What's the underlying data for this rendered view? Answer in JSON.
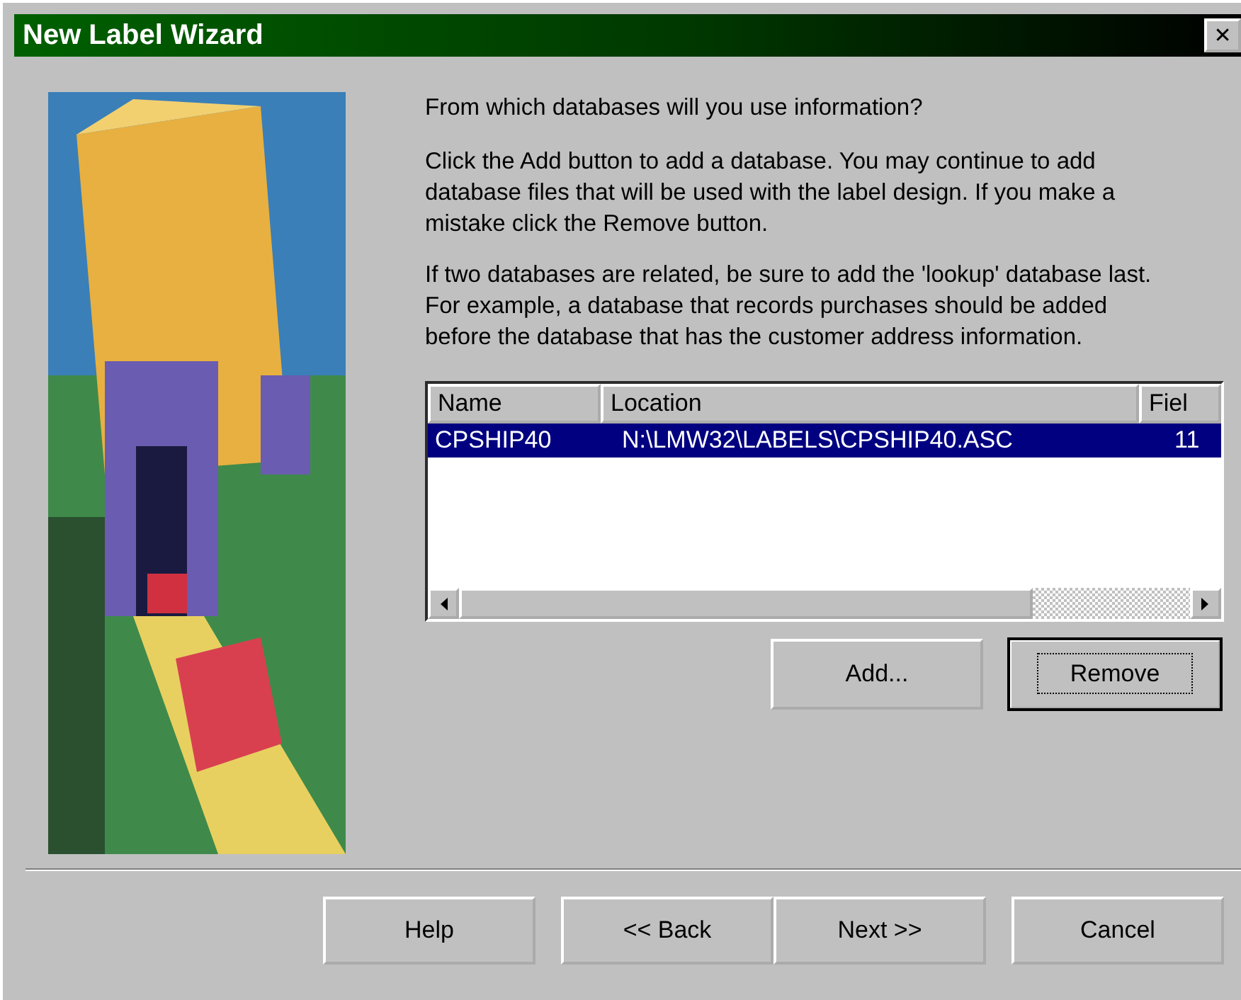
{
  "window": {
    "title": "New Label Wizard",
    "close": "✕"
  },
  "intro": {
    "question": "From which databases will you use information?",
    "paragraphs": [
      "Click the Add button to add a database.  You may continue to add database files that will be used with the label design.  If you make a mistake click the Remove button.",
      "If two databases are related, be sure to add the 'lookup' database last. For example, a database that records purchases should be added before the database that has the customer address information."
    ]
  },
  "table": {
    "columns": [
      "Name",
      "Location",
      "Fiel"
    ],
    "rows": [
      {
        "cells": [
          "CPSHIP40",
          "N:\\LMW32\\LABELS\\CPSHIP40.ASC",
          "11"
        ],
        "selected": true
      }
    ]
  },
  "list_buttons": [
    {
      "label": "Add...",
      "focused": false
    },
    {
      "label": "Remove",
      "focused": true
    }
  ],
  "footer_buttons": [
    "Help",
    "<< Back",
    "Next >>",
    "Cancel"
  ]
}
